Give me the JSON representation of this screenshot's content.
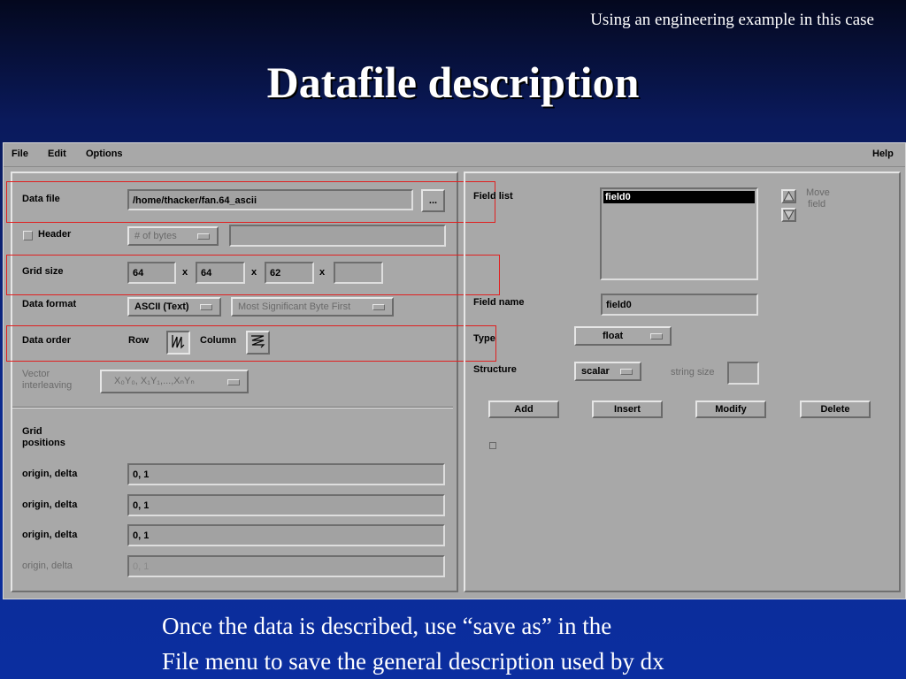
{
  "slide": {
    "subtitle": "Using an engineering example in this case",
    "title": "Datafile description",
    "caption_line1": "Once the data is described, use “save as” in the",
    "caption_line2": "File menu to save the general description used by dx"
  },
  "menubar": {
    "file": "File",
    "edit": "Edit",
    "options": "Options",
    "help": "Help"
  },
  "left": {
    "data_file_label": "Data file",
    "data_file_value": "/home/thacker/fan.64_ascii",
    "browse_button": "...",
    "header_label": "Header",
    "header_mode": "# of bytes",
    "header_value": "",
    "grid_size_label": "Grid size",
    "grid_sizes": [
      "64",
      "64",
      "62",
      ""
    ],
    "times_symbol": "x",
    "data_format_label": "Data format",
    "data_format_value": "ASCII (Text)",
    "byte_order_value": "Most Significant Byte First",
    "data_order_label": "Data order",
    "row_label": "Row",
    "column_label": "Column",
    "vector_label_1": "Vector",
    "vector_label_2": "interleaving",
    "vector_value": "X₀Y₀, X₁Y₁,...,XₙYₙ",
    "grid_positions_1": "Grid",
    "grid_positions_2": "positions",
    "origin_rows": [
      {
        "label": "origin, delta",
        "value": "0, 1"
      },
      {
        "label": "origin, delta",
        "value": "0, 1"
      },
      {
        "label": "origin, delta",
        "value": "0, 1"
      },
      {
        "label": "origin, delta",
        "value": "0, 1"
      }
    ]
  },
  "right": {
    "field_list_label": "Field list",
    "field_list_items": [
      "field0"
    ],
    "move_field_1": "Move",
    "move_field_2": "field",
    "field_name_label": "Field name",
    "field_name_value": "field0",
    "type_label": "Type",
    "type_value": "float",
    "structure_label": "Structure",
    "structure_value": "scalar",
    "string_size_label": "string size",
    "string_size_value": "",
    "buttons": [
      "Add",
      "Insert",
      "Modify",
      "Delete"
    ]
  }
}
